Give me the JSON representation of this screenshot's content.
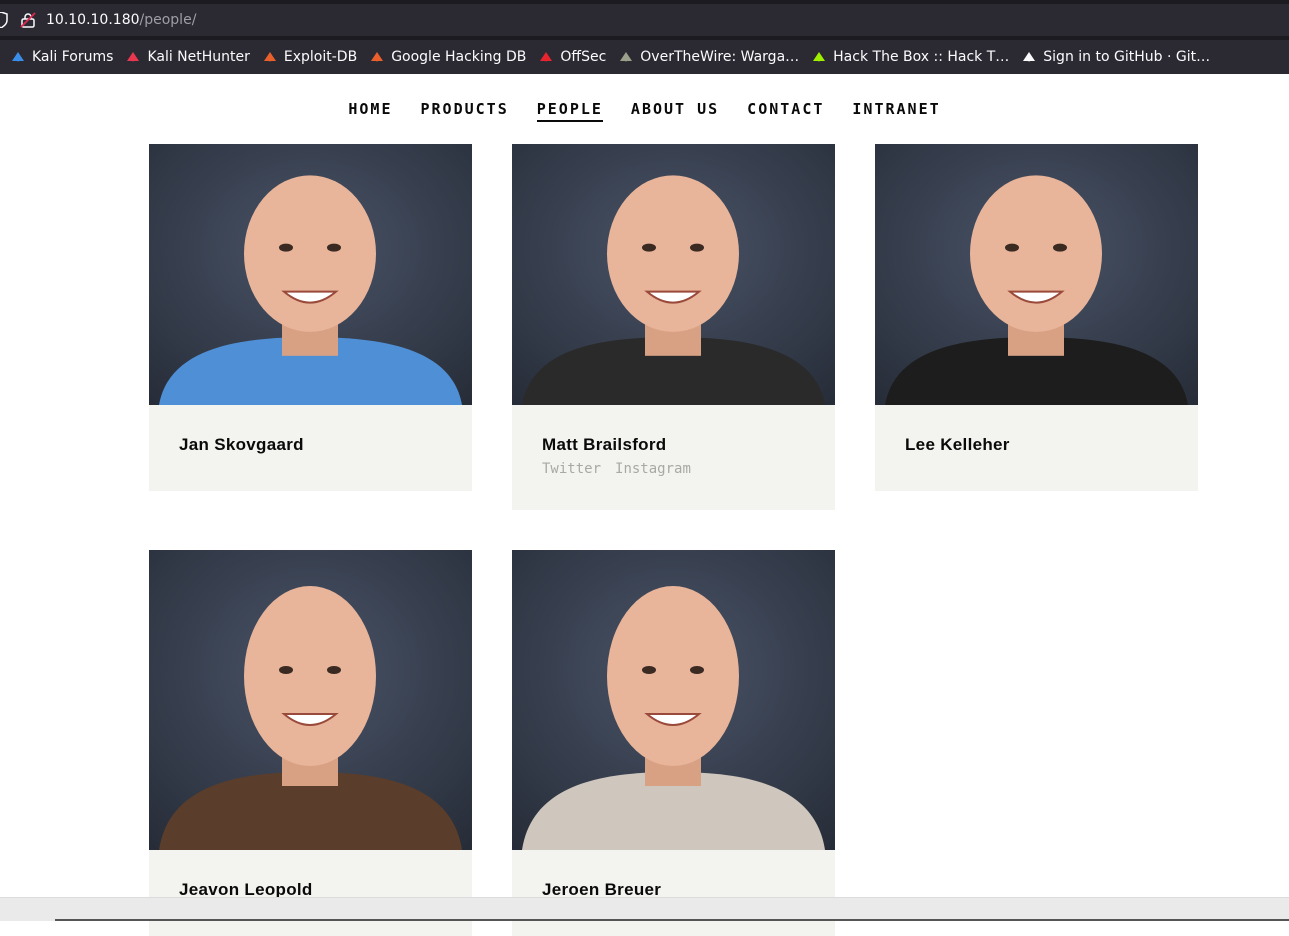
{
  "browser": {
    "url_host": "10.10.10.180",
    "url_path": "/people/",
    "bookmarks": [
      {
        "label": "Kali Forums",
        "icon": "kali-forums-icon",
        "color": "#3b8ee8"
      },
      {
        "label": "Kali NetHunter",
        "icon": "kali-nethunter-icon",
        "color": "#e8384f"
      },
      {
        "label": "Exploit-DB",
        "icon": "exploit-db-icon",
        "color": "#e9602c"
      },
      {
        "label": "Google Hacking DB",
        "icon": "ghdb-icon",
        "color": "#e9602c"
      },
      {
        "label": "OffSec",
        "icon": "offsec-icon",
        "color": "#e8242e"
      },
      {
        "label": "OverTheWire: Warga…",
        "icon": "overthewire-icon",
        "color": "#9aa08a"
      },
      {
        "label": "Hack The Box :: Hack T…",
        "icon": "hackthebox-icon",
        "color": "#9fef00"
      },
      {
        "label": "Sign in to GitHub · Git…",
        "icon": "github-icon",
        "color": "#fbfbfe"
      }
    ]
  },
  "nav": {
    "items": [
      {
        "label": "HOME",
        "active": false
      },
      {
        "label": "PRODUCTS",
        "active": false
      },
      {
        "label": "PEOPLE",
        "active": true
      },
      {
        "label": "ABOUT US",
        "active": false
      },
      {
        "label": "CONTACT",
        "active": false
      },
      {
        "label": "INTRANET",
        "active": false
      }
    ]
  },
  "people": [
    {
      "name": "Jan Skovgaard",
      "links": [],
      "shirt": "#4f8fd6"
    },
    {
      "name": "Matt Brailsford",
      "links": [
        "Twitter",
        "Instagram"
      ],
      "shirt": "#2a2a2a"
    },
    {
      "name": "Lee Kelleher",
      "links": [],
      "shirt": "#1d1d1d"
    },
    {
      "name": "Jeavon Leopold",
      "links": [],
      "shirt": "#5a3d2a"
    },
    {
      "name": "Jeroen Breuer",
      "links": [],
      "shirt": "#cfc7bd"
    }
  ]
}
